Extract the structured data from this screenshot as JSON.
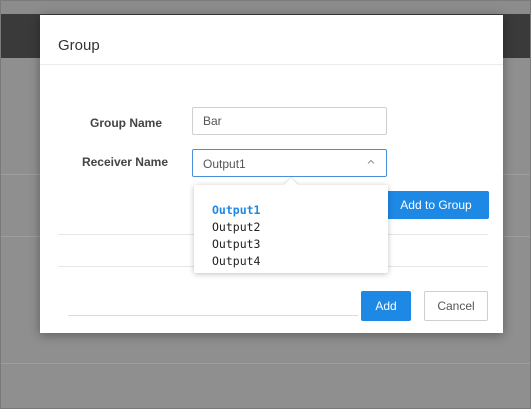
{
  "dialog": {
    "title": "Group",
    "group_name_label": "Group Name",
    "group_name_value": "Bar",
    "receiver_name_label": "Receiver Name",
    "receiver_selected": "Output1",
    "add_to_group_label": "Add to Group",
    "add_label": "Add",
    "cancel_label": "Cancel"
  },
  "dropdown": {
    "options": [
      "Output1",
      "Output2",
      "Output3",
      "Output4"
    ],
    "selected": "Output1"
  },
  "colors": {
    "primary": "#1e88e5",
    "overlay_header": "#3a3a3a",
    "overlay_body": "#8f8f8f"
  },
  "icons": {
    "select_toggle": "chevron-up-icon"
  }
}
